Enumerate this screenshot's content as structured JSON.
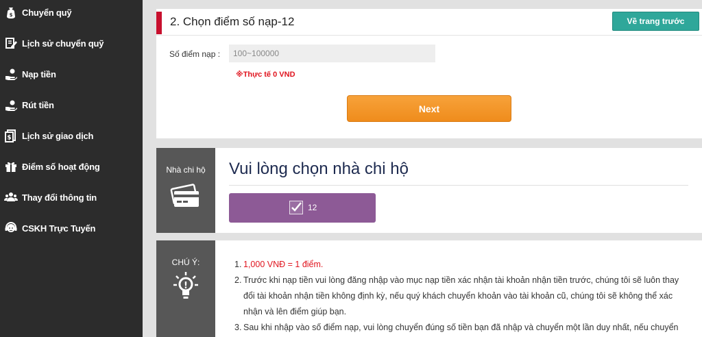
{
  "sidebar": {
    "items": [
      {
        "label": "Chuyển quỹ",
        "icon": "money-bag-icon"
      },
      {
        "label": "Lịch sử chuyển quỹ",
        "icon": "edit-note-icon"
      },
      {
        "label": "Nạp tiền",
        "icon": "hand-coin-icon"
      },
      {
        "label": "Rút tiền",
        "icon": "hand-coin-icon"
      },
      {
        "label": "Lịch sử giao dịch",
        "icon": "receipt-icon"
      },
      {
        "label": "Điểm số hoạt động",
        "icon": "gift-icon"
      },
      {
        "label": "Thay đổi thông tin",
        "icon": "users-icon"
      },
      {
        "label": "CSKH Trực Tuyến",
        "icon": "support-headset-icon"
      }
    ]
  },
  "step": {
    "title": "2. Chọn điểm số nạp-12",
    "back_label": "Về trang trước",
    "amount_label": "Số điểm nạp :",
    "amount_placeholder": "100~100000",
    "amount_value": "",
    "actual_note": "※Thực tế 0 VND",
    "next_label": "Next"
  },
  "agent": {
    "side_label": "Nhà chi hộ",
    "side_icon": "credit-card-icon",
    "title": "Vui lòng chọn nhà chi hộ",
    "option_number": "12",
    "option_checked": true
  },
  "notes": {
    "side_label": "CHÚ Ý:",
    "side_icon": "lightbulb-icon",
    "items": [
      {
        "num": "1.",
        "text": "1,000 VNĐ = 1 điểm."
      },
      {
        "num": "2.",
        "text": "Trước khi nạp tiền vui lòng đăng nhập vào mục nạp tiền xác nhận tài khoản nhận tiền trước, chúng tôi sẽ luôn thay đổi tài khoản nhận tiền không định kỳ, nếu quý khách chuyển khoản vào tài khoản cũ, chúng tôi sẽ không thể xác nhận và lên điểm giúp bạn."
      },
      {
        "num": "3.",
        "text": "Sau khi nhập vào số điểm nạp, vui lòng chuyển đúng số tiền bạn đã nhập và chuyển một lần duy nhất, nếu chuyển"
      }
    ]
  },
  "colors": {
    "sidebar_bg": "#2c2c2c",
    "accent_red": "#c8102e",
    "back_button": "#2fa79a",
    "next_button": "#ef8c1c",
    "agent_card": "#8d5a96",
    "title_navy": "#1d2a4f",
    "warning_red": "#e0141e"
  }
}
